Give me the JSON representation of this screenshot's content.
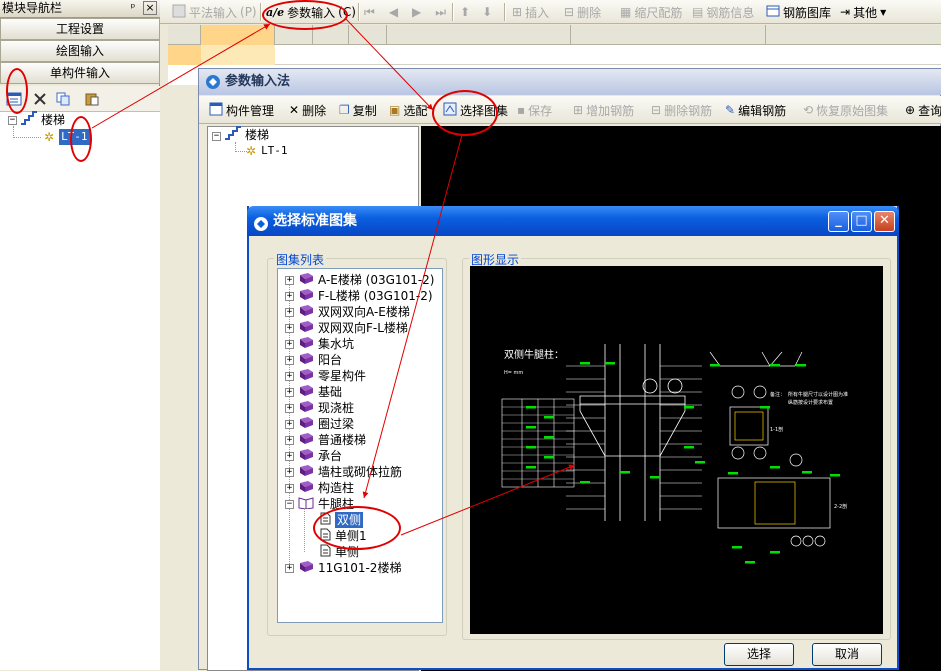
{
  "nav": {
    "title": "模块导航栏",
    "pin_glyph": "ᵖ",
    "close_glyph": "×",
    "buttons": [
      "工程设置",
      "绘图输入",
      "单构件输入"
    ],
    "tree": {
      "root": "楼梯",
      "child": "LT-1"
    }
  },
  "toolbar": {
    "items": [
      {
        "label": "平法输入",
        "key": "(P)",
        "enabled": false
      },
      {
        "label": "参数输入",
        "key": "(C)",
        "enabled": true
      },
      {
        "label": "插入",
        "enabled": false
      },
      {
        "label": "删除",
        "enabled": false
      },
      {
        "label": "缩尺配筋",
        "enabled": false
      },
      {
        "label": "钢筋信息",
        "enabled": false
      },
      {
        "label": "钢筋图库",
        "enabled": true
      },
      {
        "label": "其他",
        "enabled": true
      }
    ]
  },
  "param_window": {
    "title": "参数输入法",
    "toolbar": [
      {
        "label": "构件管理",
        "enabled": true
      },
      {
        "label": "删除",
        "enabled": true
      },
      {
        "label": "复制",
        "enabled": true
      },
      {
        "label": "选配",
        "enabled": true
      },
      {
        "label": "选择图集",
        "enabled": true
      },
      {
        "label": "保存",
        "enabled": false
      },
      {
        "label": "增加钢筋",
        "enabled": false
      },
      {
        "label": "删除钢筋",
        "enabled": false
      },
      {
        "label": "编辑钢筋",
        "enabled": true
      },
      {
        "label": "恢复原始图集",
        "enabled": false
      },
      {
        "label": "查询",
        "enabled": true
      }
    ],
    "tree": {
      "root": "楼梯",
      "child": "LT-1"
    }
  },
  "dialog": {
    "title": "选择标准图集",
    "list_group": "图集列表",
    "preview_group": "图形显示",
    "atlas": [
      "A-E楼梯 (03G101-2)",
      "F-L楼梯 (03G101-2)",
      "双网双向A-E楼梯",
      "双网双向F-L楼梯",
      "集水坑",
      "阳台",
      "零星构件",
      "基础",
      "现浇桩",
      "圈过梁",
      "普通楼梯",
      "承台",
      "墙柱或砌体拉筋",
      "构造柱",
      "牛腿柱",
      "11G101-2楼梯"
    ],
    "expanded": "牛腿柱",
    "children": [
      "双侧",
      "单侧1",
      "单侧"
    ],
    "selected_child": "双侧",
    "select_button": "选择",
    "cancel_button": "取消",
    "drawing": {
      "heading": "双侧牛腿柱：",
      "notes": [
        "备注：",
        "所有牛腿尺寸以设计图为准",
        "纵筋按设计要求布置"
      ],
      "section_1": "1-1剖",
      "section_2": "2-2剖"
    }
  },
  "colors": {
    "annotation_red": "#e00000",
    "selection_blue": "#316ac5",
    "xp_title_blue": "#0a5fe0",
    "drawing_green": "#00e000"
  }
}
